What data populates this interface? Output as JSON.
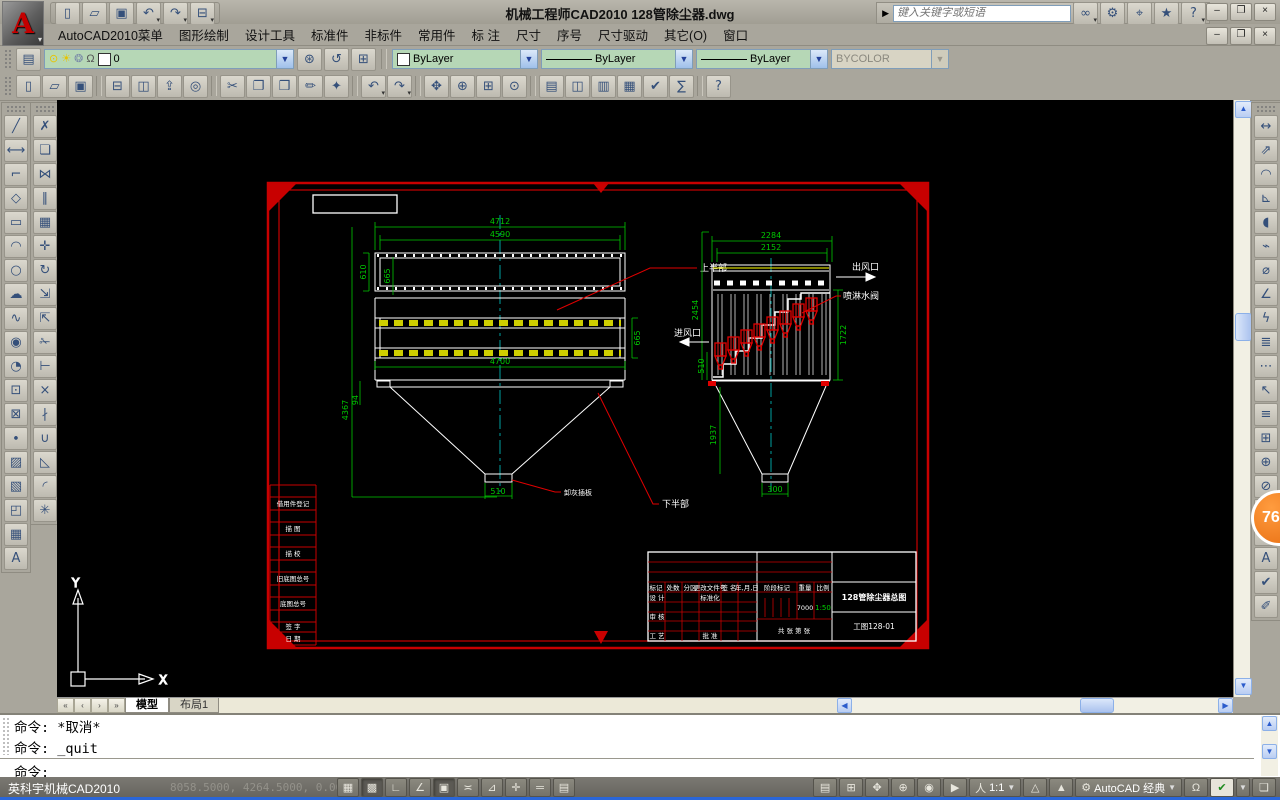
{
  "window": {
    "title": "机械工程师CAD2010  128管除尘器.dwg",
    "buttons": [
      "–",
      "❐",
      "×"
    ]
  },
  "infocenter": {
    "search_placeholder": "键入关键字或短语",
    "buttons": [
      {
        "name": "search-button",
        "glyph": "∞",
        "drop": true
      },
      {
        "name": "communication-center-button",
        "glyph": "⚙"
      },
      {
        "name": "subscription-center-button",
        "glyph": "⌖"
      },
      {
        "name": "favorites-button",
        "glyph": "★"
      },
      {
        "name": "help-button",
        "glyph": "?",
        "drop": true
      }
    ]
  },
  "qat": {
    "buttons": [
      {
        "name": "new-button",
        "glyph": "▯"
      },
      {
        "name": "open-button",
        "glyph": "▱"
      },
      {
        "name": "save-button",
        "glyph": "▣"
      },
      {
        "name": "undo-button",
        "glyph": "↶",
        "drop": true
      },
      {
        "name": "redo-button",
        "glyph": "↷",
        "drop": true
      },
      {
        "name": "plot-button",
        "glyph": "⊟",
        "drop": true
      }
    ]
  },
  "menu_bar": {
    "items": [
      "AutoCAD2010菜单",
      "图形绘制",
      "设计工具",
      "标准件",
      "非标件",
      "常用件",
      "标 注",
      "尺寸",
      "序号",
      "尺寸驱动",
      "其它(O)",
      "窗口"
    ]
  },
  "object_properties": {
    "layer_name": "0",
    "color": "ByLayer",
    "linetype": "ByLayer",
    "lineweight": "ByLayer",
    "plot_style": "BYCOLOR",
    "layer_buttons": [
      {
        "name": "make-object-layer-current-button",
        "glyph": "⊛"
      },
      {
        "name": "layer-previous-button",
        "glyph": "↺"
      },
      {
        "name": "layer-states-button",
        "glyph": "⊞"
      }
    ]
  },
  "standard_toolbar": {
    "buttons": [
      {
        "name": "new-button",
        "glyph": "▯"
      },
      {
        "name": "open-button",
        "glyph": "▱"
      },
      {
        "name": "save-button",
        "glyph": "▣"
      },
      {
        "sep": true
      },
      {
        "name": "plot-button",
        "glyph": "⊟"
      },
      {
        "name": "plot-preview-button",
        "glyph": "◫"
      },
      {
        "name": "publish-button",
        "glyph": "⇪"
      },
      {
        "name": "3d-dwf-button",
        "glyph": "◎"
      },
      {
        "sep": true
      },
      {
        "name": "cut-button",
        "glyph": "✂"
      },
      {
        "name": "copy-button",
        "glyph": "❐"
      },
      {
        "name": "paste-button",
        "glyph": "❒"
      },
      {
        "name": "match-properties-button",
        "glyph": "✏"
      },
      {
        "name": "block-editor-button",
        "glyph": "✦"
      },
      {
        "sep": true
      },
      {
        "name": "undo-button",
        "glyph": "↶",
        "drop": true
      },
      {
        "name": "redo-button",
        "glyph": "↷",
        "drop": true
      },
      {
        "sep": true
      },
      {
        "name": "pan-button",
        "glyph": "✥"
      },
      {
        "name": "zoom-realtime-button",
        "glyph": "⊕"
      },
      {
        "name": "zoom-window-button",
        "glyph": "⊞"
      },
      {
        "name": "zoom-previous-button",
        "glyph": "⊙"
      },
      {
        "sep": true
      },
      {
        "name": "properties-button",
        "glyph": "▤"
      },
      {
        "name": "designcenter-button",
        "glyph": "◫"
      },
      {
        "name": "tool-palettes-button",
        "glyph": "▥"
      },
      {
        "name": "sheet-set-manager-button",
        "glyph": "▦"
      },
      {
        "name": "markup-button",
        "glyph": "✔"
      },
      {
        "name": "quickcalc-button",
        "glyph": "∑"
      },
      {
        "sep": true
      },
      {
        "name": "help-button",
        "glyph": "?"
      }
    ]
  },
  "draw_toolbar": {
    "buttons": [
      {
        "name": "line-button",
        "glyph": "╱"
      },
      {
        "name": "construction-line-button",
        "glyph": "⟷"
      },
      {
        "name": "polyline-button",
        "glyph": "⌐"
      },
      {
        "name": "polygon-button",
        "glyph": "◇"
      },
      {
        "name": "rectangle-button",
        "glyph": "▭"
      },
      {
        "name": "arc-button",
        "glyph": "◠"
      },
      {
        "name": "circle-button",
        "glyph": "○"
      },
      {
        "name": "revision-cloud-button",
        "glyph": "☁"
      },
      {
        "name": "spline-button",
        "glyph": "∿"
      },
      {
        "name": "ellipse-button",
        "glyph": "◉"
      },
      {
        "name": "ellipse-arc-button",
        "glyph": "◔"
      },
      {
        "name": "insert-block-button",
        "glyph": "⊡"
      },
      {
        "name": "make-block-button",
        "glyph": "⊠"
      },
      {
        "name": "point-button",
        "glyph": "∙"
      },
      {
        "name": "hatch-button",
        "glyph": "▨"
      },
      {
        "name": "gradient-button",
        "glyph": "▧"
      },
      {
        "name": "region-button",
        "glyph": "◰"
      },
      {
        "name": "table-button",
        "glyph": "▦"
      },
      {
        "name": "multiline-text-button",
        "glyph": "A"
      }
    ]
  },
  "modify_toolbar": {
    "buttons": [
      {
        "name": "erase-button",
        "glyph": "✗"
      },
      {
        "name": "copy-object-button",
        "glyph": "❏"
      },
      {
        "name": "mirror-button",
        "glyph": "⋈"
      },
      {
        "name": "offset-button",
        "glyph": "∥"
      },
      {
        "name": "array-button",
        "glyph": "▦"
      },
      {
        "name": "move-button",
        "glyph": "✛"
      },
      {
        "name": "rotate-button",
        "glyph": "↻"
      },
      {
        "name": "scale-button",
        "glyph": "⇲"
      },
      {
        "name": "stretch-button",
        "glyph": "⇱"
      },
      {
        "name": "trim-button",
        "glyph": "✁"
      },
      {
        "name": "extend-button",
        "glyph": "⊢"
      },
      {
        "name": "break-at-point-button",
        "glyph": "×"
      },
      {
        "name": "break-button",
        "glyph": "∤"
      },
      {
        "name": "join-button",
        "glyph": "∪"
      },
      {
        "name": "chamfer-button",
        "glyph": "◺"
      },
      {
        "name": "fillet-button",
        "glyph": "◜"
      },
      {
        "name": "explode-button",
        "glyph": "✳"
      }
    ]
  },
  "dimension_toolbar": {
    "buttons": [
      {
        "name": "linear-dimension-button",
        "glyph": "↔"
      },
      {
        "name": "aligned-dimension-button",
        "glyph": "⇗"
      },
      {
        "name": "arc-length-dimension-button",
        "glyph": "◠"
      },
      {
        "name": "ordinate-dimension-button",
        "glyph": "⊾"
      },
      {
        "name": "radius-dimension-button",
        "glyph": "◖"
      },
      {
        "name": "jogged-dimension-button",
        "glyph": "⌁"
      },
      {
        "name": "diameter-dimension-button",
        "glyph": "⌀"
      },
      {
        "name": "angular-dimension-button",
        "glyph": "∠"
      },
      {
        "name": "quick-dimension-button",
        "glyph": "ϟ"
      },
      {
        "name": "baseline-dimension-button",
        "glyph": "≣"
      },
      {
        "name": "continue-dimension-button",
        "glyph": "⋯"
      },
      {
        "name": "quick-leader-button",
        "glyph": "↖"
      },
      {
        "name": "dimension-space-button",
        "glyph": "≡"
      },
      {
        "name": "tolerance-button",
        "glyph": "⊞"
      },
      {
        "name": "center-mark-button",
        "glyph": "⊕"
      },
      {
        "name": "dimension-inspect-button",
        "glyph": "⊘"
      },
      {
        "name": "jogged-linear-button",
        "glyph": "∿"
      },
      {
        "name": "dimension-edit-button",
        "glyph": "✎"
      },
      {
        "name": "dimension-text-edit-button",
        "glyph": "A"
      },
      {
        "name": "dimension-update-button",
        "glyph": "✔"
      },
      {
        "name": "dimension-style-button",
        "glyph": "✐"
      }
    ]
  },
  "badge": {
    "value": "76"
  },
  "layout_tabs": {
    "nav": [
      "«",
      "‹",
      "›",
      "»"
    ],
    "model": "模型",
    "layout1": "布局1"
  },
  "command_window": {
    "lines": [
      "命令: *取消*",
      "命令: _quit"
    ],
    "prompt": "命令:"
  },
  "status_bar": {
    "app_name": "英科宇机械CAD2010",
    "coordinates": "8058.5000, 4264.5000, 0.0000",
    "toggles": [
      {
        "name": "snap-toggle",
        "glyph": "▦"
      },
      {
        "name": "grid-toggle",
        "glyph": "▩",
        "pressed": true
      },
      {
        "name": "ortho-toggle",
        "glyph": "∟"
      },
      {
        "name": "polar-toggle",
        "glyph": "∠"
      },
      {
        "name": "osnap-toggle",
        "glyph": "▣",
        "pressed": true
      },
      {
        "name": "otrack-toggle",
        "glyph": "≍"
      },
      {
        "name": "ducs-toggle",
        "glyph": "⊿"
      },
      {
        "name": "dyn-toggle",
        "glyph": "✛"
      },
      {
        "name": "lineweight-toggle",
        "glyph": "═"
      },
      {
        "name": "quick-properties-toggle",
        "glyph": "▤"
      }
    ],
    "right_buttons": [
      {
        "name": "model-space-button",
        "glyph": "▤"
      },
      {
        "name": "quick-view-layouts-button",
        "glyph": "⊞"
      },
      {
        "name": "pan-button",
        "glyph": "✥"
      },
      {
        "name": "zoom-button",
        "glyph": "⊕"
      },
      {
        "name": "steering-wheel-button",
        "glyph": "◉"
      },
      {
        "name": "showmotion-button",
        "glyph": "▶"
      }
    ],
    "annotation_person": "人",
    "annotation_scale": "1:1",
    "annotation_vis_glyph": "△",
    "annotation_auto_glyph": "▲",
    "workspace_gear": "⚙",
    "workspace": "AutoCAD 经典",
    "lock_glyph": "Ω",
    "perf_glyph": "✔",
    "clean_screen_glyph": "❏"
  },
  "drawing": {
    "front_view": {
      "dim_top_outer": "4712",
      "dim_top_inner": "4590",
      "dim_left_outer": "610",
      "dim_left_inner": "665",
      "dim_right": "665",
      "dim_width": "4700",
      "dim_height": "4367",
      "dim_foot": "94",
      "dim_outlet": "510",
      "label_upper": "上半部",
      "label_lower": "下半部",
      "label_outlet": "卸灰插板"
    },
    "side_view": {
      "dim_top_outer": "2284",
      "dim_top_inner": "2152",
      "dim_left": "2454",
      "dim_right": "1722",
      "dim_inlet": "510",
      "dim_hopper": "1937",
      "dim_outlet": "300",
      "label_air_out": "出风口",
      "label_air_in": "进风口",
      "label_valve": "喷淋水阀"
    },
    "border_strip": {
      "rows": [
        "借用件登记",
        "描 图",
        "描 校",
        "旧底图总号",
        "底图总号",
        "签 字",
        "日 期"
      ]
    },
    "title_block": {
      "header_cells": [
        "标记",
        "处数",
        "分区",
        "更改文件号",
        "签 名",
        "年,月,日"
      ],
      "row_design": "设 计",
      "row_standard": "标准化",
      "row_check": "审 核",
      "row_process": "工 艺",
      "row_approve": "批 准",
      "stage_label": "阶段标记",
      "weight_label": "重量",
      "scale_label": "比例",
      "weight": "7000",
      "scale": "1:50",
      "sheets": "共 张 第 张",
      "title": "128管除尘器总图",
      "drawing_no": "工图128-01"
    }
  }
}
